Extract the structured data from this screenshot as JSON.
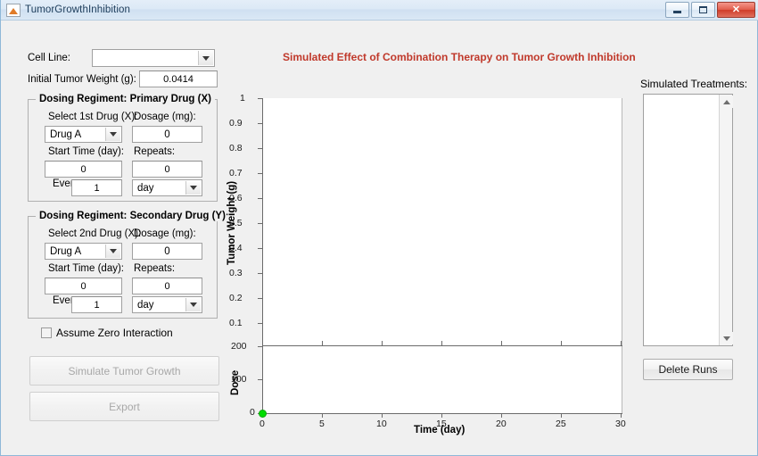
{
  "window": {
    "title": "TumorGrowthInhibition",
    "icon": "matlab-figure-icon",
    "minimize_label": "Minimize",
    "maximize_label": "Maximize",
    "close_label": "✕"
  },
  "form": {
    "cell_line_label": "Cell Line:",
    "cell_line_value": "",
    "initial_weight_label": "Initial Tumor Weight (g):",
    "initial_weight_value": "0.0414"
  },
  "primary_panel": {
    "title": "Dosing Regiment: Primary Drug (X)",
    "drug_label": "Select 1st Drug (X):",
    "drug_value": "Drug A",
    "dosage_label": "Dosage (mg):",
    "dosage_value": "0",
    "start_time_label": "Start Time (day):",
    "start_time_value": "0",
    "repeats_label": "Repeats:",
    "repeats_value": "0",
    "every_label": "Every:",
    "every_value": "1",
    "every_unit": "day"
  },
  "secondary_panel": {
    "title": "Dosing Regiment: Secondary Drug (Y)",
    "drug_label": "Select 2nd Drug (X):",
    "drug_value": "Drug A",
    "dosage_label": "Dosage (mg):",
    "dosage_value": "0",
    "start_time_label": "Start Time (day):",
    "start_time_value": "0",
    "repeats_label": "Repeats:",
    "repeats_value": "0",
    "every_label": "Every:",
    "every_value": "1",
    "every_unit": "day"
  },
  "options": {
    "zero_interaction_label": "Assume Zero Interaction",
    "zero_interaction_checked": false
  },
  "actions": {
    "simulate_label": "Simulate Tumor Growth",
    "simulate_enabled": false,
    "export_label": "Export",
    "export_enabled": false
  },
  "treatments": {
    "label": "Simulated Treatments:",
    "items": [],
    "delete_label": "Delete Runs",
    "scroll_up_icon": "triangle-up-icon",
    "scroll_down_icon": "triangle-down-icon"
  },
  "chart_data": {
    "type": "line",
    "title": "Simulated Effect of Combination Therapy on Tumor Growth Inhibition",
    "title_color": "#c0392b",
    "grid": false,
    "legend": null,
    "xlabel": "Time (day)",
    "x_ticks": [
      0,
      5,
      10,
      15,
      20,
      25,
      30
    ],
    "xlim": [
      0,
      30
    ],
    "subplots": [
      {
        "name": "tumor-weight-subplot",
        "ylabel": "Tumor Weight (g)",
        "ylim": [
          0,
          1
        ],
        "y_ticks": [
          1,
          0.9,
          0.8,
          0.7,
          0.6,
          0.5,
          0.4,
          0.3,
          0.2,
          0.1
        ],
        "series": []
      },
      {
        "name": "dose-subplot",
        "ylabel": "Dose",
        "ylim": [
          0,
          200
        ],
        "y_ticks": [
          200,
          100,
          0
        ],
        "series": [
          {
            "name": "dose-origin-marker",
            "color": "#00dd00",
            "points": [
              {
                "x": 0,
                "y": 0
              }
            ]
          }
        ]
      }
    ]
  }
}
